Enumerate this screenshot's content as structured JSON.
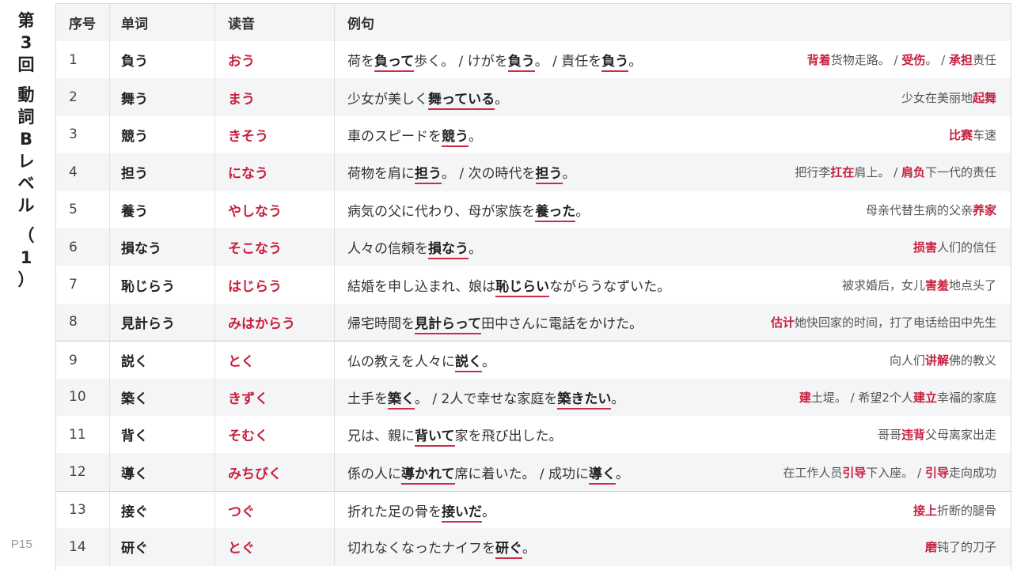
{
  "side_title_chars": [
    "第",
    "3",
    "回",
    "",
    "動",
    "詞",
    "B",
    "レ",
    "ベ",
    "ル",
    "",
    "（",
    "1",
    "）"
  ],
  "page_number": "P15",
  "headers": {
    "idx": "序号",
    "word": "单词",
    "reading": "读音",
    "example": "例句"
  },
  "rows": [
    {
      "idx": "1",
      "word": "負う",
      "reading": "おう",
      "jp": [
        [
          "荷を",
          0
        ],
        [
          "負って",
          1
        ],
        [
          "歩く。 / けがを",
          0
        ],
        [
          "負う",
          1
        ],
        [
          "。 / 責任を",
          0
        ],
        [
          "負う",
          1
        ],
        [
          "。",
          0
        ]
      ],
      "cn": [
        [
          "背着",
          1
        ],
        [
          "货物走路。 / ",
          0
        ],
        [
          "受伤",
          1
        ],
        [
          "。 / ",
          0
        ],
        [
          "承担",
          1
        ],
        [
          "责任",
          0
        ]
      ],
      "group_top": false
    },
    {
      "idx": "2",
      "word": "舞う",
      "reading": "まう",
      "jp": [
        [
          "少女が美しく",
          0
        ],
        [
          "舞っている",
          1
        ],
        [
          "。",
          0
        ]
      ],
      "cn": [
        [
          "少女在美丽地",
          0
        ],
        [
          "起舞",
          1
        ]
      ],
      "group_top": false
    },
    {
      "idx": "3",
      "word": "競う",
      "reading": "きそう",
      "jp": [
        [
          "車のスピードを",
          0
        ],
        [
          "競う",
          1
        ],
        [
          "。",
          0
        ]
      ],
      "cn": [
        [
          "比赛",
          1
        ],
        [
          "车速",
          0
        ]
      ],
      "group_top": false
    },
    {
      "idx": "4",
      "word": "担う",
      "reading": "になう",
      "jp": [
        [
          "荷物を肩に",
          0
        ],
        [
          "担う",
          1
        ],
        [
          "。 / 次の時代を",
          0
        ],
        [
          "担う",
          1
        ],
        [
          "。",
          0
        ]
      ],
      "cn": [
        [
          "把行李",
          0
        ],
        [
          "扛在",
          1
        ],
        [
          "肩上。 / ",
          0
        ],
        [
          "肩负",
          1
        ],
        [
          "下一代的责任",
          0
        ]
      ],
      "group_top": false
    },
    {
      "idx": "5",
      "word": "養う",
      "reading": "やしなう",
      "jp": [
        [
          "病気の父に代わり、母が家族を",
          0
        ],
        [
          "養った",
          1
        ],
        [
          "。",
          0
        ]
      ],
      "cn": [
        [
          "母亲代替生病的父亲",
          0
        ],
        [
          "养家",
          1
        ]
      ],
      "group_top": false
    },
    {
      "idx": "6",
      "word": "損なう",
      "reading": "そこなう",
      "jp": [
        [
          "人々の信頼を",
          0
        ],
        [
          "損なう",
          1
        ],
        [
          "。",
          0
        ]
      ],
      "cn": [
        [
          "损害",
          1
        ],
        [
          "人们的信任",
          0
        ]
      ],
      "group_top": false
    },
    {
      "idx": "7",
      "word": "恥じらう",
      "reading": "はじらう",
      "jp": [
        [
          "結婚を申し込まれ、娘は",
          0
        ],
        [
          "恥じらい",
          1
        ],
        [
          "ながらうなずいた。",
          0
        ]
      ],
      "cn": [
        [
          "被求婚后，女儿",
          0
        ],
        [
          "害羞",
          1
        ],
        [
          "地点头了",
          0
        ]
      ],
      "group_top": false
    },
    {
      "idx": "8",
      "word": "見計らう",
      "reading": "みはからう",
      "jp": [
        [
          "帰宅時間を",
          0
        ],
        [
          "見計らって",
          1
        ],
        [
          "田中さんに電話をかけた。",
          0
        ]
      ],
      "cn": [
        [
          "估计",
          1
        ],
        [
          "她快回家的时间，打了电话给田中先生",
          0
        ]
      ],
      "group_top": false
    },
    {
      "idx": "9",
      "word": "説く",
      "reading": "とく",
      "jp": [
        [
          "仏の教えを人々に",
          0
        ],
        [
          "説く",
          1
        ],
        [
          "。",
          0
        ]
      ],
      "cn": [
        [
          "向人们",
          0
        ],
        [
          "讲解",
          1
        ],
        [
          "佛的教义",
          0
        ]
      ],
      "group_top": true
    },
    {
      "idx": "10",
      "word": "築く",
      "reading": "きずく",
      "jp": [
        [
          "土手を",
          0
        ],
        [
          "築く",
          1
        ],
        [
          "。 / 2人で幸せな家庭を",
          0
        ],
        [
          "築きたい",
          1
        ],
        [
          "。",
          0
        ]
      ],
      "cn": [
        [
          "建",
          1
        ],
        [
          "土堤。 / 希望2个人",
          0
        ],
        [
          "建立",
          1
        ],
        [
          "幸福的家庭",
          0
        ]
      ],
      "group_top": false
    },
    {
      "idx": "11",
      "word": "背く",
      "reading": "そむく",
      "jp": [
        [
          "兄は、親に",
          0
        ],
        [
          "背いて",
          1
        ],
        [
          "家を飛び出した。",
          0
        ]
      ],
      "cn": [
        [
          "哥哥",
          0
        ],
        [
          "违背",
          1
        ],
        [
          "父母离家出走",
          0
        ]
      ],
      "group_top": false
    },
    {
      "idx": "12",
      "word": "導く",
      "reading": "みちびく",
      "jp": [
        [
          "係の人に",
          0
        ],
        [
          "導かれて",
          1
        ],
        [
          "席に着いた。 / 成功に",
          0
        ],
        [
          "導く",
          1
        ],
        [
          "。",
          0
        ]
      ],
      "cn": [
        [
          "在工作人员",
          0
        ],
        [
          "引导",
          1
        ],
        [
          "下入座。 / ",
          0
        ],
        [
          "引导",
          1
        ],
        [
          "走向成功",
          0
        ]
      ],
      "group_top": false
    },
    {
      "idx": "13",
      "word": "接ぐ",
      "reading": "つぐ",
      "jp": [
        [
          "折れた足の骨を",
          0
        ],
        [
          "接いだ",
          1
        ],
        [
          "。",
          0
        ]
      ],
      "cn": [
        [
          "接上",
          1
        ],
        [
          "折断的腿骨",
          0
        ]
      ],
      "group_top": true
    },
    {
      "idx": "14",
      "word": "研ぐ",
      "reading": "とぐ",
      "jp": [
        [
          "切れなくなったナイフを",
          0
        ],
        [
          "研ぐ",
          1
        ],
        [
          "。",
          0
        ]
      ],
      "cn": [
        [
          "磨",
          1
        ],
        [
          "钝了的刀子",
          0
        ]
      ],
      "group_top": false
    }
  ],
  "colors": {
    "accent": "#c8203f",
    "underline": "#d02a48",
    "stripe": "#f4f5f7",
    "border": "#d8d8d8"
  }
}
